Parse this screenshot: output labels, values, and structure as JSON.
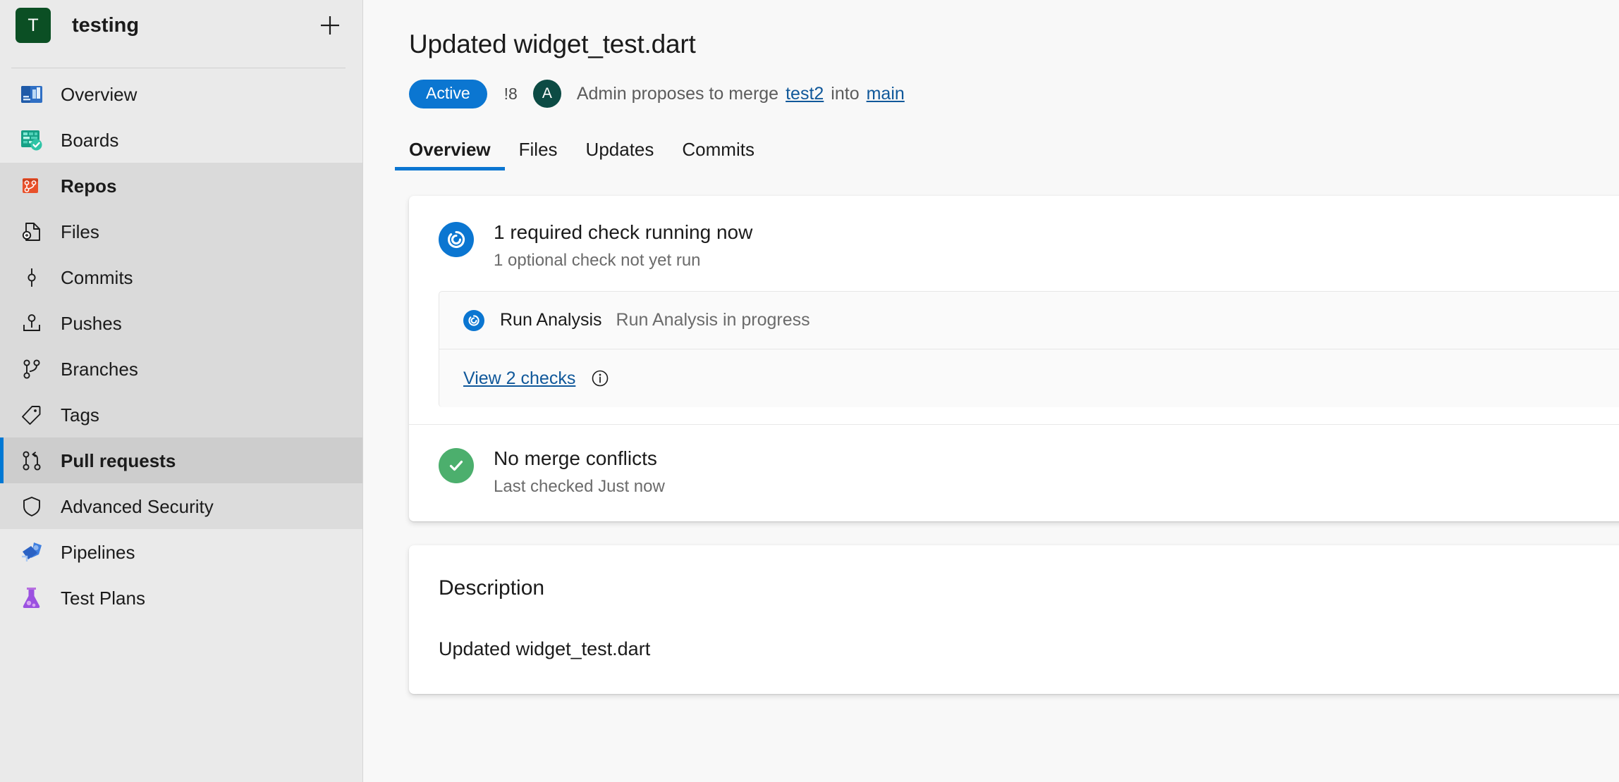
{
  "sidebar": {
    "project": {
      "initial": "T",
      "name": "testing",
      "add_label": "+"
    },
    "items": [
      {
        "label": "Overview",
        "icon": "overview-icon",
        "state": "normal"
      },
      {
        "label": "Boards",
        "icon": "boards-icon",
        "state": "normal"
      },
      {
        "label": "Repos",
        "icon": "repos-icon",
        "state": "hub-active"
      },
      {
        "label": "Files",
        "icon": "files-icon",
        "state": "sub"
      },
      {
        "label": "Commits",
        "icon": "commits-icon",
        "state": "sub"
      },
      {
        "label": "Pushes",
        "icon": "pushes-icon",
        "state": "sub"
      },
      {
        "label": "Branches",
        "icon": "branches-icon",
        "state": "sub"
      },
      {
        "label": "Tags",
        "icon": "tags-icon",
        "state": "sub"
      },
      {
        "label": "Pull requests",
        "icon": "pull-request-icon",
        "state": "sub-selected"
      },
      {
        "label": "Advanced Security",
        "icon": "shield-icon",
        "state": "sub-last"
      },
      {
        "label": "Pipelines",
        "icon": "pipelines-icon",
        "state": "normal"
      },
      {
        "label": "Test Plans",
        "icon": "test-plans-icon",
        "state": "normal"
      }
    ]
  },
  "pr": {
    "title": "Updated widget_test.dart",
    "status": "Active",
    "id": "!8",
    "author_initial": "A",
    "merge_prefix": "Admin proposes to merge",
    "source_branch": "test2",
    "merge_middle": "into",
    "target_branch": "main"
  },
  "tabs": [
    {
      "label": "Overview",
      "active": true
    },
    {
      "label": "Files",
      "active": false
    },
    {
      "label": "Updates",
      "active": false
    },
    {
      "label": "Commits",
      "active": false
    }
  ],
  "checks": {
    "summary_title": "1 required check running now",
    "summary_sub": "1 optional check not yet run",
    "detail": {
      "name": "Run Analysis",
      "status": "Run Analysis in progress"
    },
    "view_link": "View 2 checks"
  },
  "merge": {
    "title": "No merge conflicts",
    "sub": "Last checked Just now"
  },
  "description": {
    "heading": "Description",
    "body": "Updated widget_test.dart"
  },
  "colors": {
    "accent": "#0b76d1",
    "success": "#4caf6d",
    "link": "#10589a",
    "sidebar_bg": "#eaeaea",
    "project_avatar": "#0b4f24"
  }
}
